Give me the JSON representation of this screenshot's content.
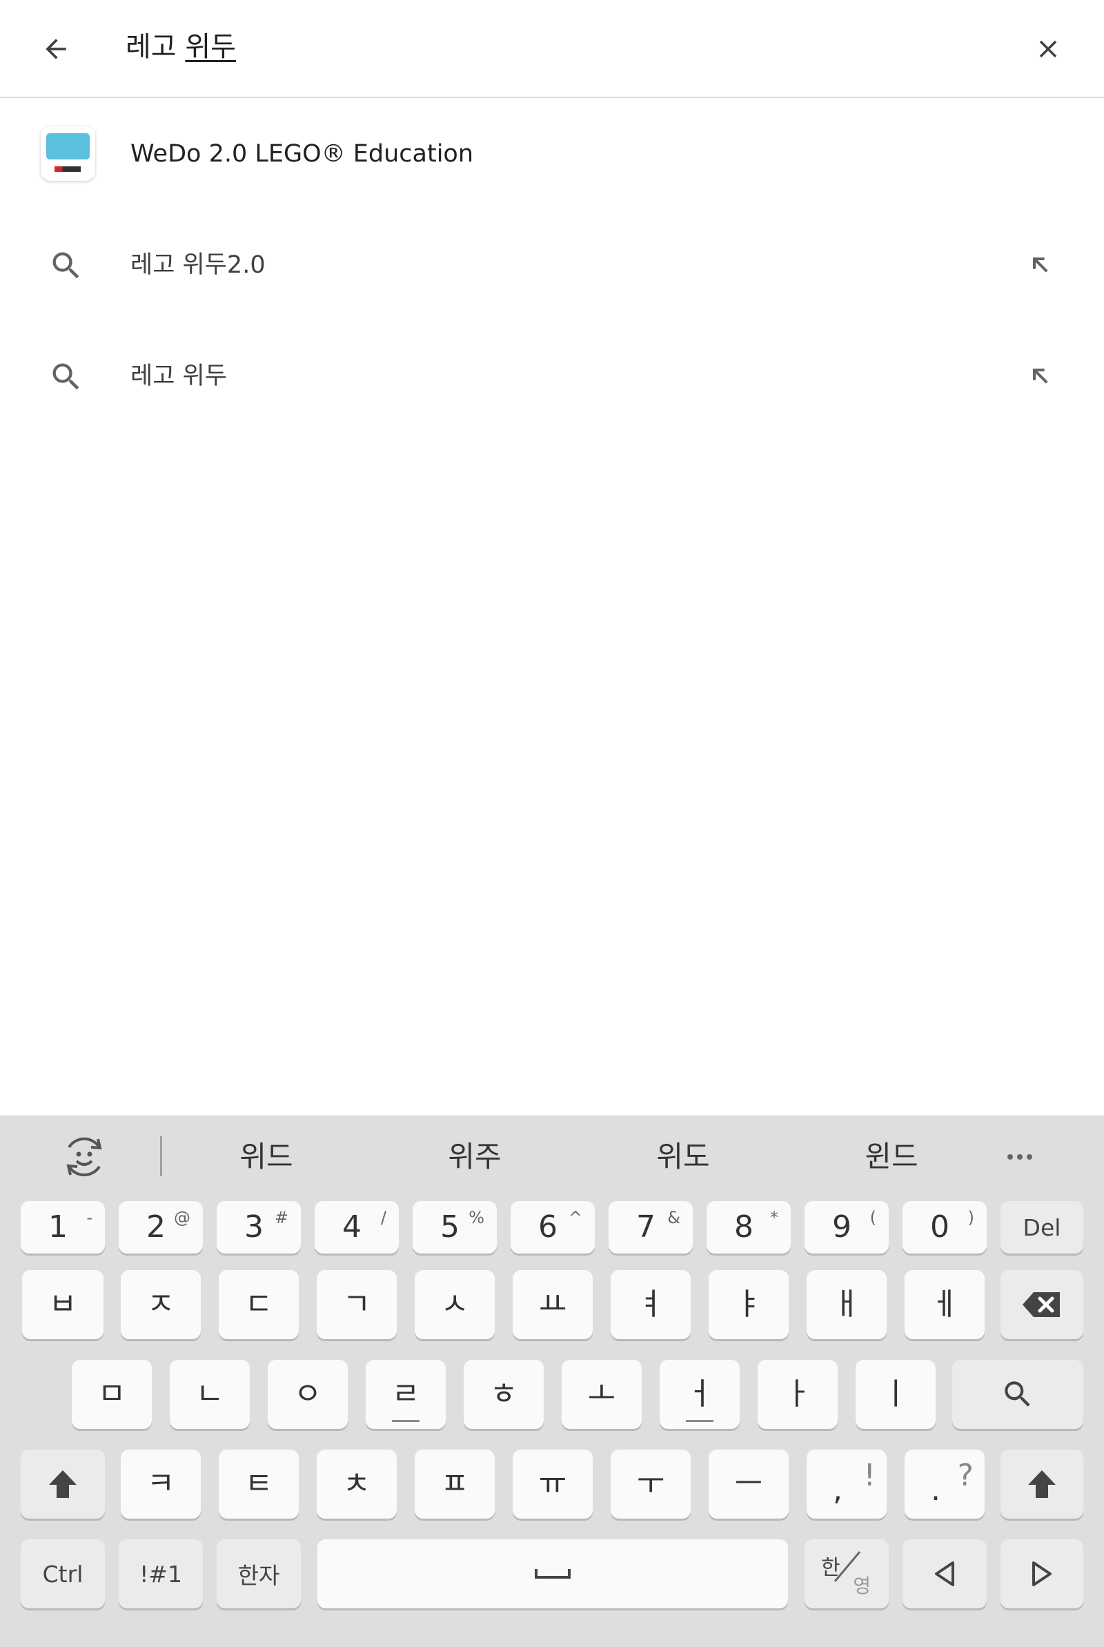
{
  "search": {
    "query_committed": "레고 ",
    "query_composing": "위두"
  },
  "suggestions": {
    "app": {
      "label": "WeDo 2.0 LEGO® Education"
    },
    "queries": [
      "레고 위두2.0",
      "레고 위두"
    ]
  },
  "keyboard": {
    "candidates": [
      "위드",
      "위주",
      "위도",
      "윈드"
    ],
    "number_row": [
      {
        "main": "1",
        "hint": "-"
      },
      {
        "main": "2",
        "hint": "@"
      },
      {
        "main": "3",
        "hint": "#"
      },
      {
        "main": "4",
        "hint": "/"
      },
      {
        "main": "5",
        "hint": "%"
      },
      {
        "main": "6",
        "hint": "^"
      },
      {
        "main": "7",
        "hint": "&"
      },
      {
        "main": "8",
        "hint": "*"
      },
      {
        "main": "9",
        "hint": "("
      },
      {
        "main": "0",
        "hint": ")"
      }
    ],
    "del_label": "Del",
    "row1": [
      "ㅂ",
      "ㅈ",
      "ㄷ",
      "ㄱ",
      "ㅅ",
      "ㅛ",
      "ㅕ",
      "ㅑ",
      "ㅐ",
      "ㅔ"
    ],
    "row2": [
      "ㅁ",
      "ㄴ",
      "ㅇ",
      "ㄹ",
      "ㅎ",
      "ㅗ",
      "ㅓ",
      "ㅏ",
      "ㅣ"
    ],
    "row3": [
      "ㅋ",
      "ㅌ",
      "ㅊ",
      "ㅍ",
      "ㅠ",
      "ㅜ",
      "ㅡ"
    ],
    "comma": {
      "main": ",",
      "alt": "!"
    },
    "period": {
      "main": ".",
      "alt": "?"
    },
    "ctrl_label": "Ctrl",
    "symbols_label": "!#1",
    "hanja_label": "한자",
    "lang_han": "한",
    "lang_yeong": "영"
  },
  "colors": {
    "keyboard_bg": "#dedede",
    "key_bg": "#fafafa",
    "fn_key_bg": "#ebebeb",
    "icon_gray": "#5f6368"
  }
}
